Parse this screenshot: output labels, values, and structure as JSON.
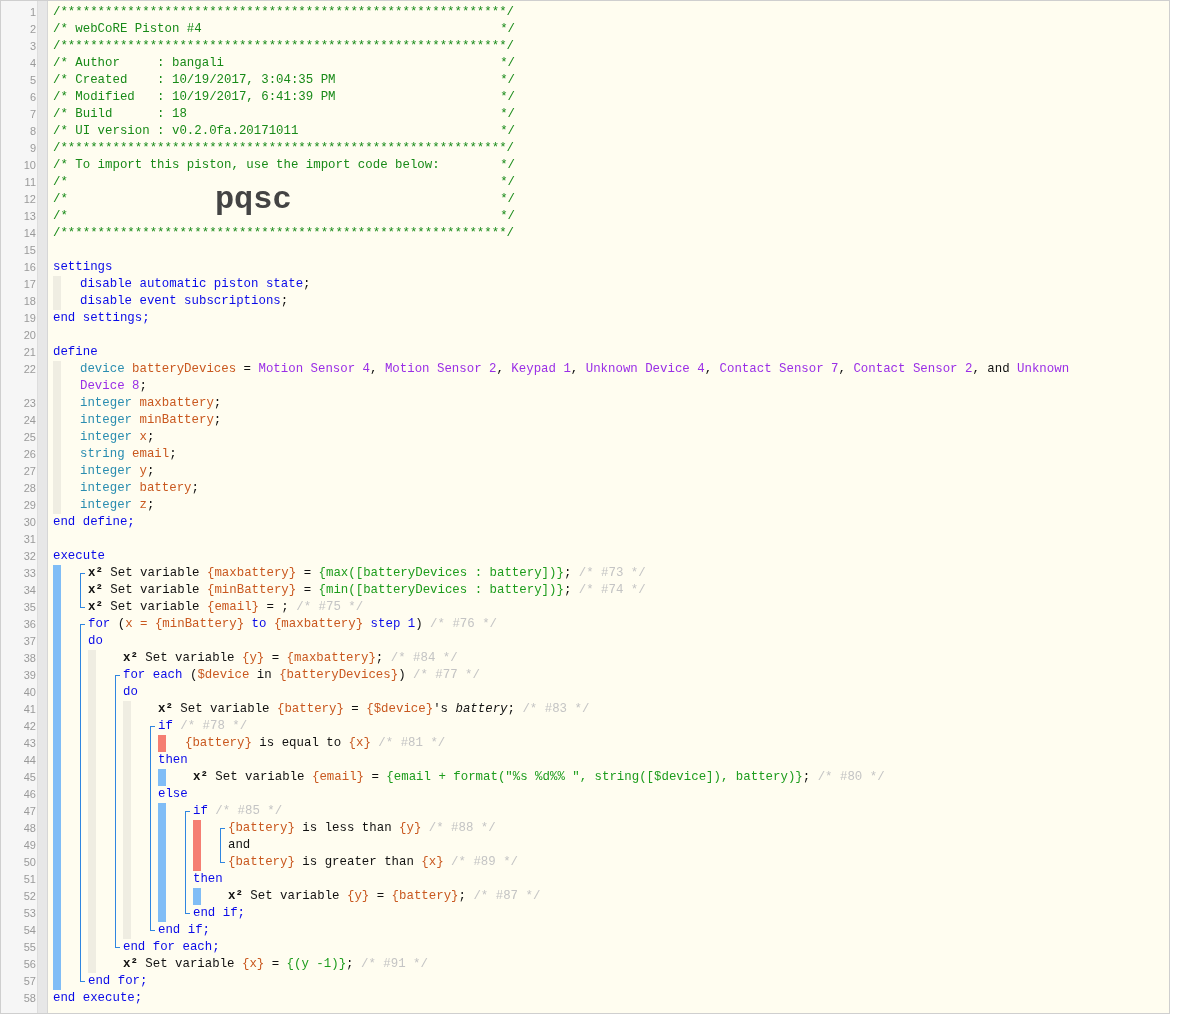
{
  "code": [
    {
      "kind": "banner",
      "n": "1",
      "text": "/************************************************************/"
    },
    {
      "kind": "banner",
      "n": "2",
      "text": "/* webCoRE Piston #4",
      "end": "*/"
    },
    {
      "kind": "banner",
      "n": "3",
      "text": "/************************************************************/"
    },
    {
      "kind": "banner",
      "n": "4",
      "text": "/* Author     : bangali",
      "end": "*/"
    },
    {
      "kind": "banner",
      "n": "5",
      "text": "/* Created    : 10/19/2017, 3:04:35 PM",
      "end": "*/"
    },
    {
      "kind": "banner",
      "n": "6",
      "text": "/* Modified   : 10/19/2017, 6:41:39 PM",
      "end": "*/"
    },
    {
      "kind": "banner",
      "n": "7",
      "text": "/* Build      : 18",
      "end": "*/"
    },
    {
      "kind": "banner",
      "n": "8",
      "text": "/* UI version : v0.2.0fa.20171011",
      "end": "*/"
    },
    {
      "kind": "banner",
      "n": "9",
      "text": "/************************************************************/"
    },
    {
      "kind": "banner",
      "n": "10",
      "text": "/* To import this piston, use the import code below:",
      "end": "*/"
    },
    {
      "kind": "banner",
      "n": "11",
      "text": "/*",
      "end": "*/"
    },
    {
      "kind": "banner",
      "n": "12",
      "text": "/*",
      "code": "pqsc",
      "end": "*/"
    },
    {
      "kind": "banner",
      "n": "13",
      "text": "/*",
      "end": "*/"
    },
    {
      "kind": "banner",
      "n": "14",
      "text": "/************************************************************/"
    },
    {
      "kind": "blank",
      "n": "15"
    },
    {
      "kind": "line",
      "n": "16",
      "tokens": [
        {
          "kind": "kw",
          "text": "settings"
        }
      ]
    },
    {
      "kind": "declarations",
      "color": "#efede2",
      "children": [
        {
          "kind": "line",
          "n": "17",
          "tokens": [
            {
              "kind": "kw",
              "text": "disable automatic piston state"
            },
            {
              "kind": "plain",
              "text": ";"
            }
          ]
        },
        {
          "kind": "line",
          "n": "18",
          "tokens": [
            {
              "kind": "kw",
              "text": "disable event subscriptions"
            },
            {
              "kind": "plain",
              "text": ";"
            }
          ]
        }
      ]
    },
    {
      "kind": "line",
      "n": "19",
      "tokens": [
        {
          "kind": "kw",
          "text": "end settings;"
        }
      ]
    },
    {
      "kind": "blank",
      "n": "20"
    },
    {
      "kind": "line",
      "n": "21",
      "tokens": [
        {
          "kind": "kw",
          "text": "define"
        }
      ]
    },
    {
      "kind": "declarations",
      "color": "#efede2",
      "children": [
        {
          "kind": "line",
          "n": "22",
          "tokens": [
            {
              "kind": "type",
              "text": "device "
            },
            {
              "kind": "var",
              "text": "batteryDevices"
            },
            {
              "kind": "plain",
              "text": " = "
            },
            {
              "kind": "dev",
              "text": "Motion Sensor 4"
            },
            {
              "kind": "plain",
              "text": ", "
            },
            {
              "kind": "dev",
              "text": "Motion Sensor 2"
            },
            {
              "kind": "plain",
              "text": ", "
            },
            {
              "kind": "dev",
              "text": "Keypad 1"
            },
            {
              "kind": "plain",
              "text": ", "
            },
            {
              "kind": "dev",
              "text": "Unknown Device 4"
            },
            {
              "kind": "plain",
              "text": ", "
            },
            {
              "kind": "dev",
              "text": "Contact Sensor 7"
            },
            {
              "kind": "plain",
              "text": ", "
            },
            {
              "kind": "dev",
              "text": "Contact Sensor 2"
            },
            {
              "kind": "plain",
              "text": ", and "
            },
            {
              "kind": "dev",
              "text": "Unknown Device 8"
            },
            {
              "kind": "plain",
              "text": ";"
            }
          ]
        },
        {
          "kind": "line",
          "n": "23",
          "tokens": [
            {
              "kind": "type",
              "text": "integer "
            },
            {
              "kind": "var",
              "text": "maxbattery"
            },
            {
              "kind": "plain",
              "text": ";"
            }
          ]
        },
        {
          "kind": "line",
          "n": "24",
          "tokens": [
            {
              "kind": "type",
              "text": "integer "
            },
            {
              "kind": "var",
              "text": "minBattery"
            },
            {
              "kind": "plain",
              "text": ";"
            }
          ]
        },
        {
          "kind": "line",
          "n": "25",
          "tokens": [
            {
              "kind": "type",
              "text": "integer "
            },
            {
              "kind": "var",
              "text": "x"
            },
            {
              "kind": "plain",
              "text": ";"
            }
          ]
        },
        {
          "kind": "line",
          "n": "26",
          "tokens": [
            {
              "kind": "type",
              "text": "string "
            },
            {
              "kind": "var",
              "text": "email"
            },
            {
              "kind": "plain",
              "text": ";"
            }
          ]
        },
        {
          "kind": "line",
          "n": "27",
          "tokens": [
            {
              "kind": "type",
              "text": "integer "
            },
            {
              "kind": "var",
              "text": "y"
            },
            {
              "kind": "plain",
              "text": ";"
            }
          ]
        },
        {
          "kind": "line",
          "n": "28",
          "tokens": [
            {
              "kind": "type",
              "text": "integer "
            },
            {
              "kind": "var",
              "text": "battery"
            },
            {
              "kind": "plain",
              "text": ";"
            }
          ]
        },
        {
          "kind": "line",
          "n": "29",
          "tokens": [
            {
              "kind": "type",
              "text": "integer "
            },
            {
              "kind": "var",
              "text": "z"
            },
            {
              "kind": "plain",
              "text": ";"
            }
          ]
        }
      ]
    },
    {
      "kind": "line",
      "n": "30",
      "tokens": [
        {
          "kind": "kw",
          "text": "end define;"
        }
      ]
    },
    {
      "kind": "blank",
      "n": "31"
    },
    {
      "kind": "line",
      "n": "32",
      "tokens": [
        {
          "kind": "kw",
          "text": "execute"
        }
      ]
    },
    {
      "kind": "statements",
      "color": "#80bdf6",
      "children": [
        {
          "kind": "group",
          "children": [
            {
              "kind": "line",
              "n": "33",
              "tokens": [
                {
                  "kind": "sym",
                  "text": "x²"
                },
                {
                  "kind": "plain",
                  "text": " Set variable "
                },
                {
                  "kind": "var",
                  "text": "{maxbattery}"
                },
                {
                  "kind": "plain",
                  "text": " = "
                },
                {
                  "kind": "expr",
                  "text": "{max([batteryDevices : battery])}"
                },
                {
                  "kind": "plain",
                  "text": "; "
                },
                {
                  "kind": "note",
                  "text": "/* #73 */"
                }
              ]
            },
            {
              "kind": "line",
              "n": "34",
              "tokens": [
                {
                  "kind": "sym",
                  "text": "x²"
                },
                {
                  "kind": "plain",
                  "text": " Set variable "
                },
                {
                  "kind": "var",
                  "text": "{minBattery}"
                },
                {
                  "kind": "plain",
                  "text": " = "
                },
                {
                  "kind": "expr",
                  "text": "{min([batteryDevices : battery])}"
                },
                {
                  "kind": "plain",
                  "text": "; "
                },
                {
                  "kind": "note",
                  "text": "/* #74 */"
                }
              ]
            },
            {
              "kind": "line",
              "n": "35",
              "tokens": [
                {
                  "kind": "sym",
                  "text": "x²"
                },
                {
                  "kind": "plain",
                  "text": " Set variable "
                },
                {
                  "kind": "var",
                  "text": "{email}"
                },
                {
                  "kind": "plain",
                  "text": " = ; "
                },
                {
                  "kind": "note",
                  "text": "/* #75 */"
                }
              ]
            }
          ]
        },
        {
          "kind": "group",
          "children": [
            {
              "kind": "line",
              "n": "36",
              "tokens": [
                {
                  "kind": "kw",
                  "text": "for"
                },
                {
                  "kind": "plain",
                  "text": " ("
                },
                {
                  "kind": "var",
                  "text": "x = {minBattery}"
                },
                {
                  "kind": "kw",
                  "text": " to "
                },
                {
                  "kind": "var",
                  "text": "{maxbattery}"
                },
                {
                  "kind": "kw",
                  "text": " step 1"
                },
                {
                  "kind": "plain",
                  "text": ") "
                },
                {
                  "kind": "note",
                  "text": "/* #76 */"
                }
              ]
            },
            {
              "kind": "line",
              "n": "37",
              "tokens": [
                {
                  "kind": "kw",
                  "text": "do"
                }
              ]
            },
            {
              "kind": "statements",
              "color": "#efede2",
              "children": [
                {
                  "kind": "line",
                  "n": "38",
                  "tokens": [
                    {
                      "kind": "sym",
                      "text": "x²"
                    },
                    {
                      "kind": "plain",
                      "text": " Set variable "
                    },
                    {
                      "kind": "var",
                      "text": "{y}"
                    },
                    {
                      "kind": "plain",
                      "text": " = "
                    },
                    {
                      "kind": "var",
                      "text": "{maxbattery}"
                    },
                    {
                      "kind": "plain",
                      "text": "; "
                    },
                    {
                      "kind": "note",
                      "text": "/* #84 */"
                    }
                  ]
                },
                {
                  "kind": "group",
                  "children": [
                    {
                      "kind": "line",
                      "n": "39",
                      "tokens": [
                        {
                          "kind": "kw",
                          "text": "for each"
                        },
                        {
                          "kind": "plain",
                          "text": " ("
                        },
                        {
                          "kind": "var",
                          "text": "$device"
                        },
                        {
                          "kind": "plain",
                          "text": " in "
                        },
                        {
                          "kind": "var",
                          "text": "{batteryDevices}"
                        },
                        {
                          "kind": "plain",
                          "text": ") "
                        },
                        {
                          "kind": "note",
                          "text": "/* #77 */"
                        }
                      ]
                    },
                    {
                      "kind": "line",
                      "n": "40",
                      "tokens": [
                        {
                          "kind": "kw",
                          "text": "do"
                        }
                      ]
                    },
                    {
                      "kind": "statements",
                      "color": "#efede2",
                      "children": [
                        {
                          "kind": "line",
                          "n": "41",
                          "tokens": [
                            {
                              "kind": "sym",
                              "text": "x²"
                            },
                            {
                              "kind": "plain",
                              "text": " Set variable "
                            },
                            {
                              "kind": "var",
                              "text": "{battery}"
                            },
                            {
                              "kind": "plain",
                              "text": " = "
                            },
                            {
                              "kind": "var",
                              "text": "{$device}"
                            },
                            {
                              "kind": "plain",
                              "text": "'s "
                            },
                            {
                              "kind": "italic",
                              "text": "battery"
                            },
                            {
                              "kind": "plain",
                              "text": "; "
                            },
                            {
                              "kind": "note",
                              "text": "/* #83 */"
                            }
                          ]
                        },
                        {
                          "kind": "group",
                          "children": [
                            {
                              "kind": "line",
                              "n": "42",
                              "tokens": [
                                {
                                  "kind": "kw",
                                  "text": "if "
                                },
                                {
                                  "kind": "note",
                                  "text": "/* #78 */"
                                }
                              ]
                            },
                            {
                              "kind": "conditions",
                              "color": "#f57e72",
                              "children": [
                                {
                                  "kind": "line",
                                  "n": "43",
                                  "tokens": [
                                    {
                                      "kind": "var",
                                      "text": "{battery}"
                                    },
                                    {
                                      "kind": "plain",
                                      "text": " is equal to "
                                    },
                                    {
                                      "kind": "var",
                                      "text": "{x} "
                                    },
                                    {
                                      "kind": "note",
                                      "text": "/* #81 */"
                                    }
                                  ]
                                }
                              ]
                            },
                            {
                              "kind": "line",
                              "n": "44",
                              "tokens": [
                                {
                                  "kind": "kw",
                                  "text": "then"
                                }
                              ]
                            },
                            {
                              "kind": "statements",
                              "color": "#80bdf6",
                              "children": [
                                {
                                  "kind": "line",
                                  "n": "45",
                                  "tokens": [
                                    {
                                      "kind": "sym",
                                      "text": "x²"
                                    },
                                    {
                                      "kind": "plain",
                                      "text": " Set variable "
                                    },
                                    {
                                      "kind": "var",
                                      "text": "{email}"
                                    },
                                    {
                                      "kind": "plain",
                                      "text": " = "
                                    },
                                    {
                                      "kind": "expr",
                                      "text": "{email + format(\"%s %d%% \", string([$device]), battery)}"
                                    },
                                    {
                                      "kind": "plain",
                                      "text": "; "
                                    },
                                    {
                                      "kind": "note",
                                      "text": "/* #80 */"
                                    }
                                  ]
                                }
                              ]
                            },
                            {
                              "kind": "line",
                              "n": "46",
                              "tokens": [
                                {
                                  "kind": "kw",
                                  "text": "else"
                                }
                              ]
                            },
                            {
                              "kind": "statements",
                              "color": "#80bdf6",
                              "children": [
                                {
                                  "kind": "group",
                                  "children": [
                                    {
                                      "kind": "line",
                                      "n": "47",
                                      "tokens": [
                                        {
                                          "kind": "kw",
                                          "text": "if "
                                        },
                                        {
                                          "kind": "note",
                                          "text": "/* #85 */"
                                        }
                                      ]
                                    },
                                    {
                                      "kind": "conditions",
                                      "color": "#f57e72",
                                      "children": [
                                        {
                                          "kind": "group",
                                          "children": [
                                            {
                                              "kind": "line",
                                              "n": "48",
                                              "tokens": [
                                                {
                                                  "kind": "var",
                                                  "text": "{battery}"
                                                },
                                                {
                                                  "kind": "plain",
                                                  "text": " is less than "
                                                },
                                                {
                                                  "kind": "var",
                                                  "text": "{y} "
                                                },
                                                {
                                                  "kind": "note",
                                                  "text": "/* #88 */"
                                                }
                                              ]
                                            },
                                            {
                                              "kind": "line",
                                              "n": "49",
                                              "tokens": [
                                                {
                                                  "kind": "plain",
                                                  "text": "and"
                                                }
                                              ]
                                            },
                                            {
                                              "kind": "line",
                                              "n": "50",
                                              "tokens": [
                                                {
                                                  "kind": "var",
                                                  "text": "{battery}"
                                                },
                                                {
                                                  "kind": "plain",
                                                  "text": " is greater than "
                                                },
                                                {
                                                  "kind": "var",
                                                  "text": "{x} "
                                                },
                                                {
                                                  "kind": "note",
                                                  "text": "/* #89 */"
                                                }
                                              ]
                                            }
                                          ]
                                        }
                                      ]
                                    },
                                    {
                                      "kind": "line",
                                      "n": "51",
                                      "tokens": [
                                        {
                                          "kind": "kw",
                                          "text": "then"
                                        }
                                      ]
                                    },
                                    {
                                      "kind": "statements",
                                      "color": "#80bdf6",
                                      "children": [
                                        {
                                          "kind": "line",
                                          "n": "52",
                                          "tokens": [
                                            {
                                              "kind": "sym",
                                              "text": "x²"
                                            },
                                            {
                                              "kind": "plain",
                                              "text": " Set variable "
                                            },
                                            {
                                              "kind": "var",
                                              "text": "{y}"
                                            },
                                            {
                                              "kind": "plain",
                                              "text": " = "
                                            },
                                            {
                                              "kind": "var",
                                              "text": "{battery}"
                                            },
                                            {
                                              "kind": "plain",
                                              "text": "; "
                                            },
                                            {
                                              "kind": "note",
                                              "text": "/* #87 */"
                                            }
                                          ]
                                        }
                                      ]
                                    },
                                    {
                                      "kind": "line",
                                      "n": "53",
                                      "tokens": [
                                        {
                                          "kind": "kw",
                                          "text": "end if;"
                                        }
                                      ]
                                    }
                                  ]
                                }
                              ]
                            },
                            {
                              "kind": "line",
                              "n": "54",
                              "tokens": [
                                {
                                  "kind": "kw",
                                  "text": "end if;"
                                }
                              ]
                            }
                          ]
                        }
                      ]
                    },
                    {
                      "kind": "line",
                      "n": "55",
                      "tokens": [
                        {
                          "kind": "kw",
                          "text": "end for each;"
                        }
                      ]
                    }
                  ]
                },
                {
                  "kind": "line",
                  "n": "56",
                  "tokens": [
                    {
                      "kind": "sym",
                      "text": "x²"
                    },
                    {
                      "kind": "plain",
                      "text": " Set variable "
                    },
                    {
                      "kind": "var",
                      "text": "{x}"
                    },
                    {
                      "kind": "plain",
                      "text": " = "
                    },
                    {
                      "kind": "expr",
                      "text": "{(y -1)}"
                    },
                    {
                      "kind": "plain",
                      "text": "; "
                    },
                    {
                      "kind": "note",
                      "text": "/* #91 */"
                    }
                  ]
                }
              ]
            },
            {
              "kind": "line",
              "n": "57",
              "tokens": [
                {
                  "kind": "kw",
                  "text": "end for;"
                }
              ]
            }
          ]
        }
      ]
    },
    {
      "kind": "line",
      "n": "58",
      "tokens": [
        {
          "kind": "kw",
          "text": "end execute;"
        }
      ]
    }
  ]
}
